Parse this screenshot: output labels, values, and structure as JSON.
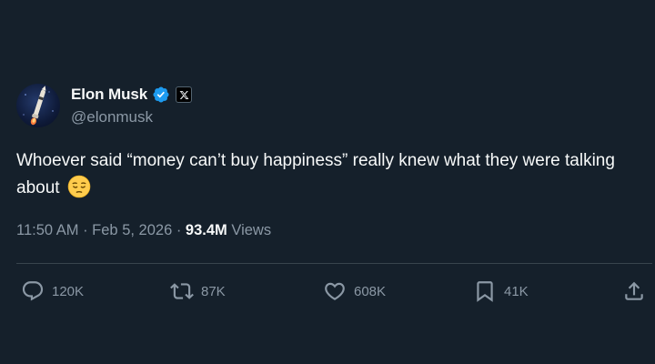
{
  "author": {
    "display_name": "Elon Musk",
    "handle": "@elonmusk",
    "verified": true,
    "affiliation_icon": "x-logo-icon",
    "avatar_icon": "avatar-image"
  },
  "post": {
    "text": "Whoever said “money can’t buy happiness” really knew what they were talking about",
    "emoji": "pensive-face-emoji"
  },
  "meta": {
    "time": "11:50 AM",
    "separator1": " · ",
    "date": "Feb 5, 2026",
    "separator2": " · ",
    "views_count": "93.4M",
    "views_label": "Views"
  },
  "actions": {
    "replies": "120K",
    "reposts": "87K",
    "likes": "608K",
    "bookmarks": "41K"
  },
  "colors": {
    "background": "#15202b",
    "text_primary": "#f7f9f9",
    "text_secondary": "#8b98a5",
    "verified_blue": "#1d9bf0",
    "divider": "#38444d"
  }
}
